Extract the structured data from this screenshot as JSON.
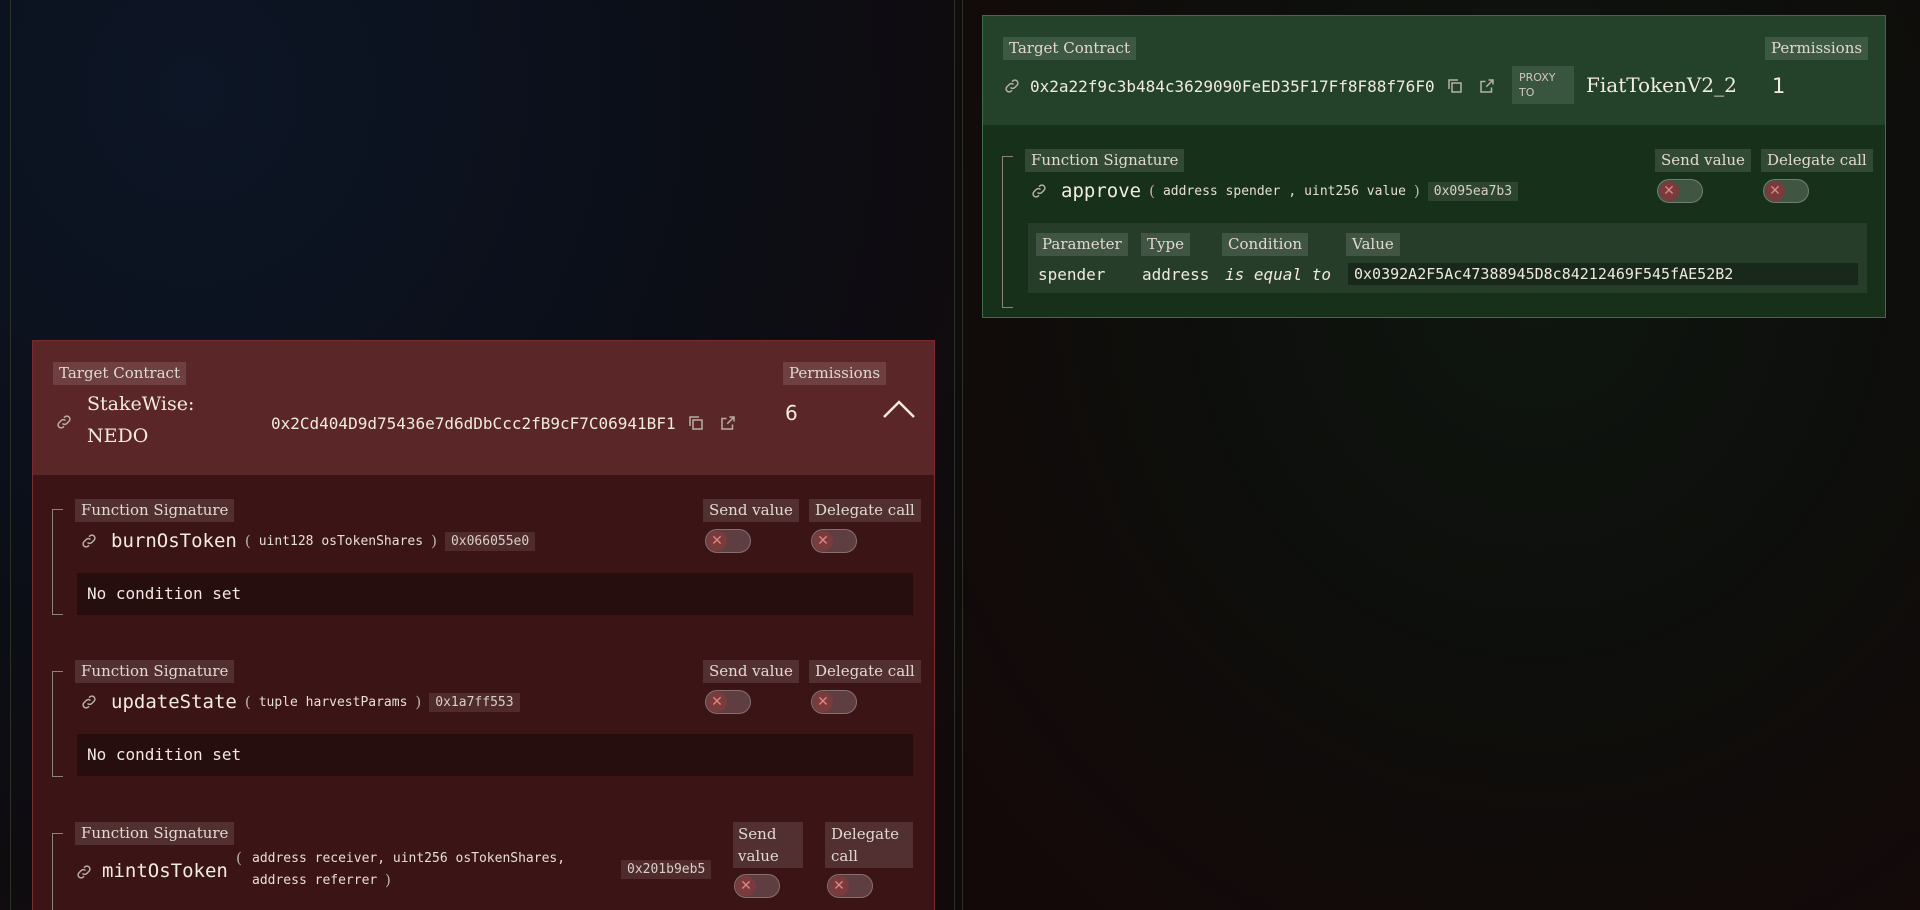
{
  "common": {
    "target_contract_label": "Target Contract",
    "permissions_label": "Permissions",
    "function_signature_label": "Function Signature",
    "send_value_label": "Send value",
    "delegate_call_label": "Delegate call",
    "no_condition_text": "No condition set"
  },
  "green_panel": {
    "address": "0x2a22f9c3b484c3629090FeED35F17Ff8F88f76F0",
    "proxy_label": "PROXY TO",
    "proxy_name": "FiatTokenV2_2",
    "permissions_count": "1",
    "function": {
      "name": "approve",
      "params": [
        {
          "text": "address spender"
        },
        {
          "text": "uint256 value"
        }
      ],
      "selector": "0x095ea7b3",
      "condition_table": {
        "headers": [
          "Parameter",
          "Type",
          "Condition",
          "Value"
        ],
        "row": {
          "parameter": "spender",
          "type": "address",
          "condition": "is equal to",
          "value": "0x0392A2F5Ac47388945D8c84212469F545fAE52B2"
        }
      }
    }
  },
  "red_panel": {
    "name_line1": "StakeWise:",
    "name_line2": "NEDO",
    "address": "0x2Cd404D9d75436e7d6dDbCcc2fB9cF7C06941BF1",
    "permissions_count": "6",
    "functions": [
      {
        "name": "burnOsToken",
        "params": [
          {
            "text": "uint128 osTokenShares"
          }
        ],
        "selector": "0x066055e0"
      },
      {
        "name": "updateState",
        "params": [
          {
            "text": "tuple harvestParams"
          }
        ],
        "selector": "0x1a7ff553"
      },
      {
        "name": "mintOsToken",
        "params_line1": "address receiver, uint256 osTokenShares,",
        "params_line2": "address referrer",
        "selector": "0x201b9eb5",
        "send_value_line1": "Send",
        "send_value_line2": "value",
        "delegate_call_line1": "Delegate",
        "delegate_call_line2": "call"
      }
    ]
  },
  "colors": {
    "green_panel": "#163019",
    "red_panel": "#3b1416",
    "toggle_off_knob": "#7a3b3c"
  },
  "icons": [
    "link-icon",
    "copy-icon",
    "external-link-icon",
    "chevron-up-icon",
    "close-icon"
  ]
}
